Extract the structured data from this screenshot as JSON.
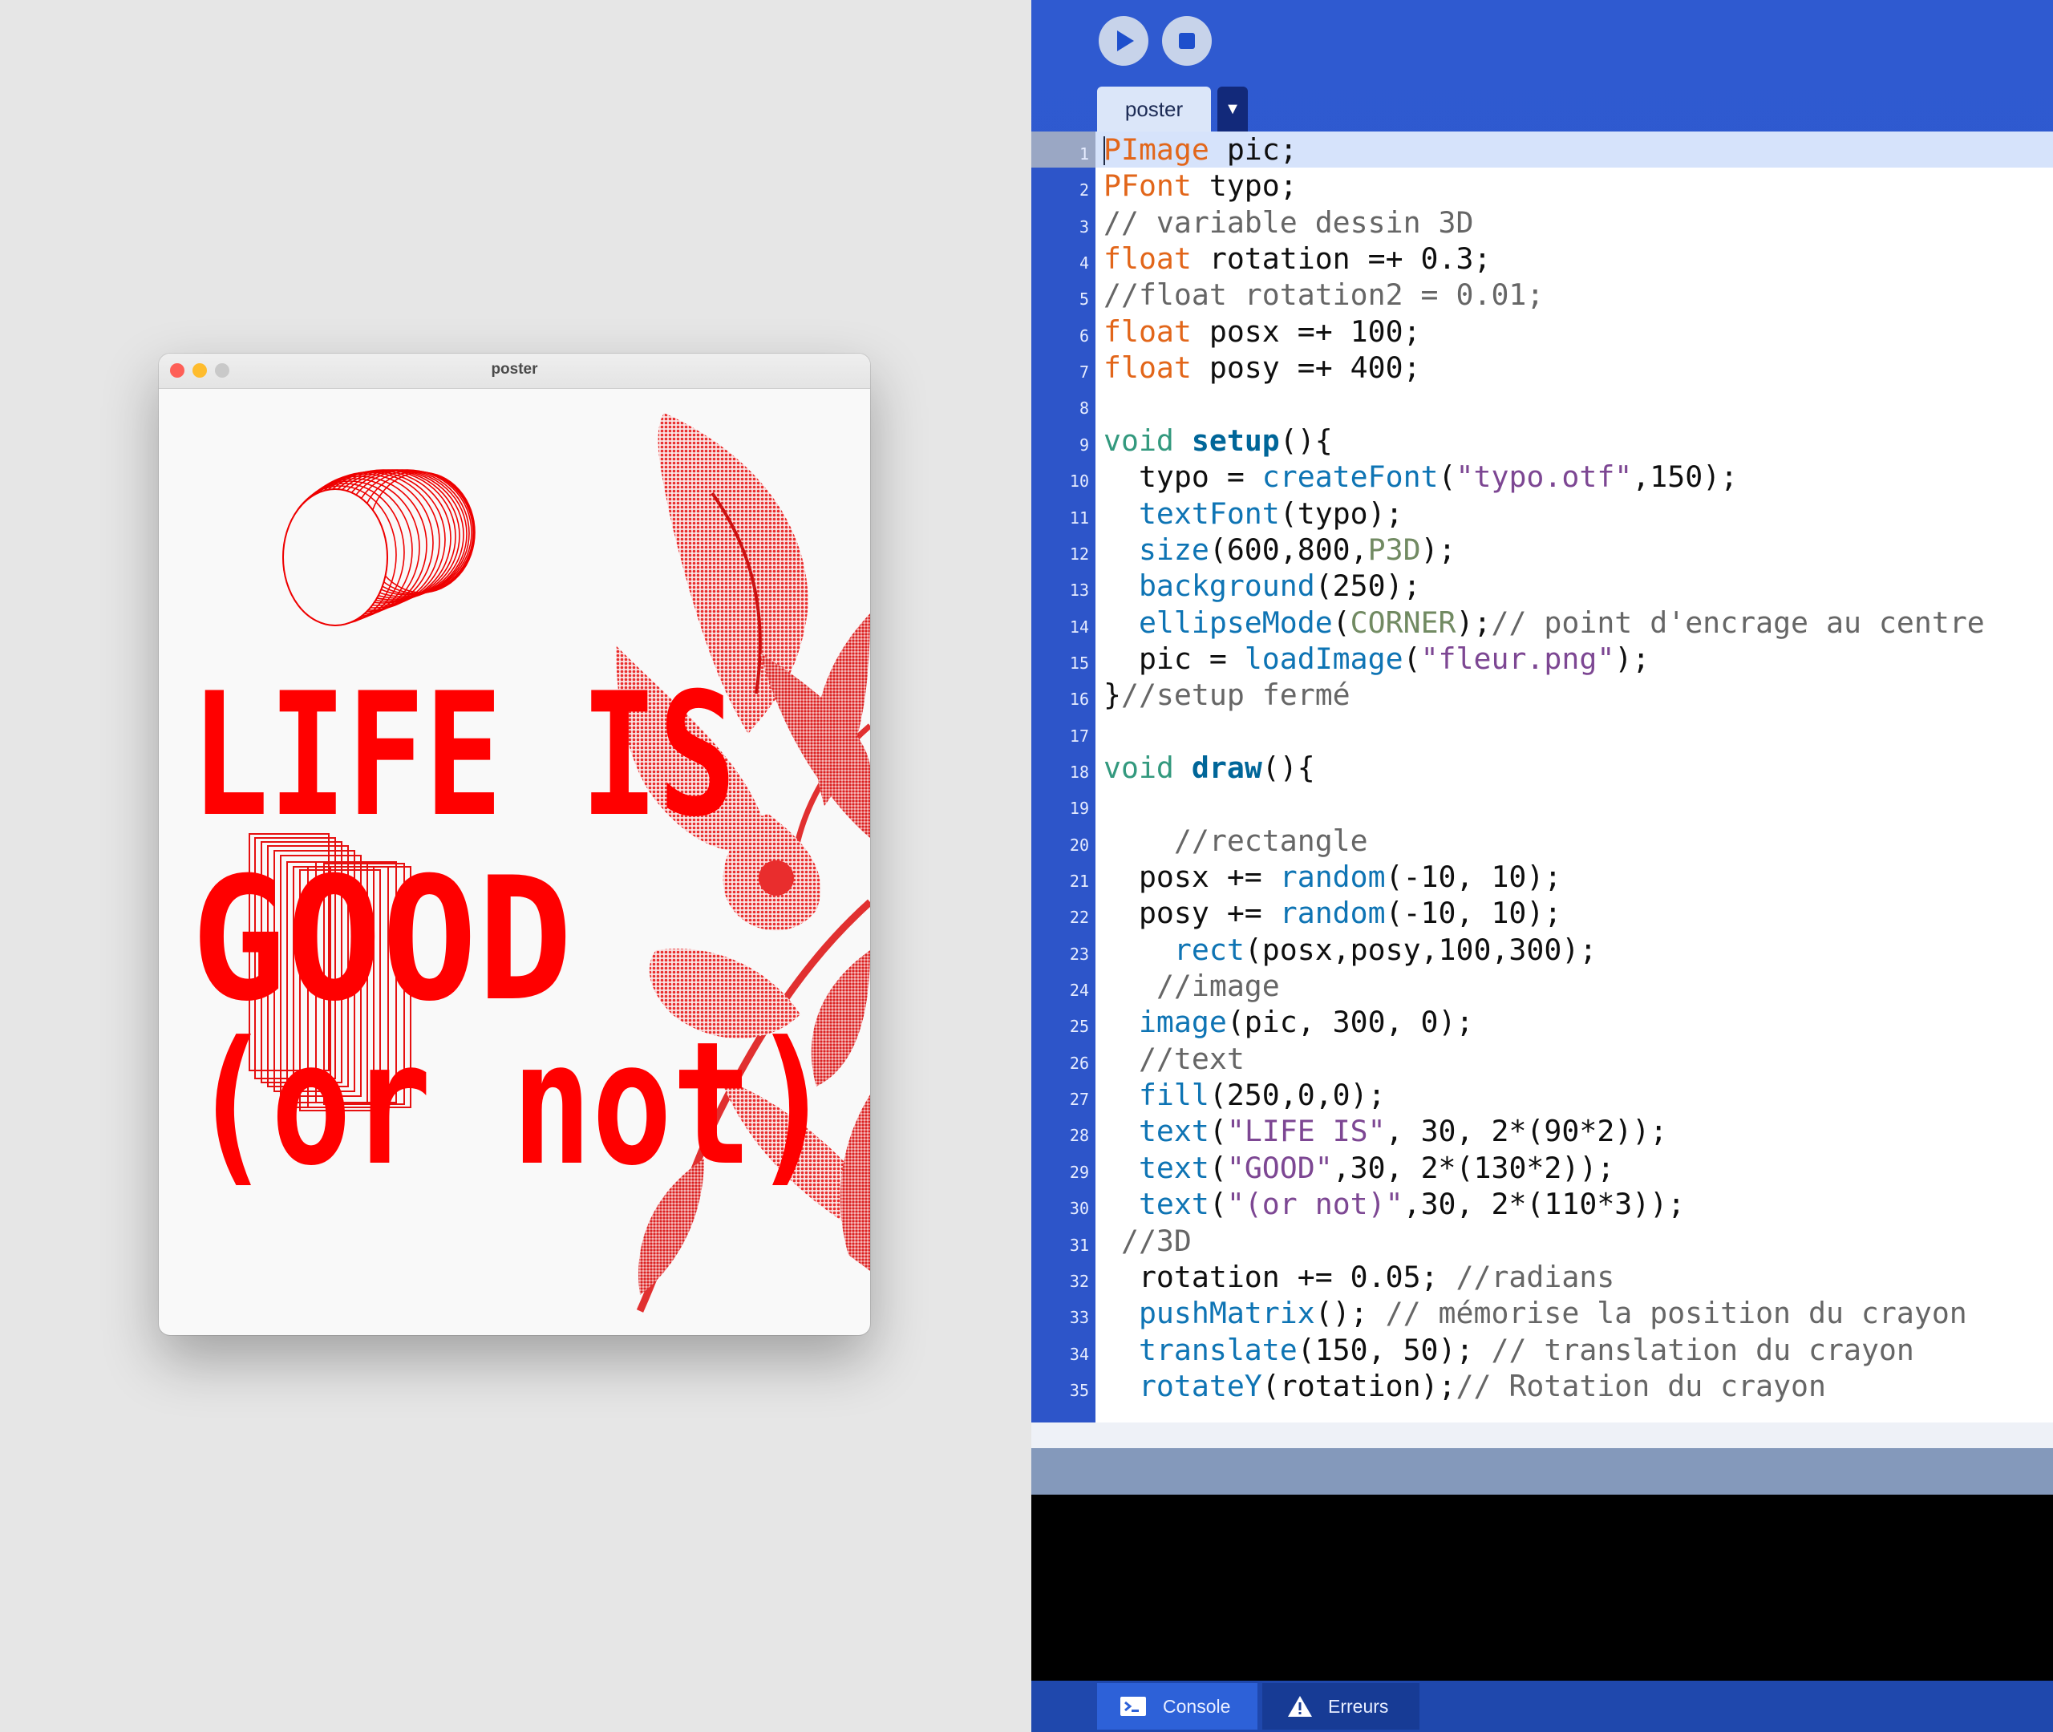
{
  "sketch_window": {
    "title": "poster",
    "poster": {
      "lines": [
        "LIFE IS",
        "GOOD",
        "(or not)"
      ],
      "text_color": "#ff0000",
      "background": "#f9f9f9"
    }
  },
  "ide": {
    "toolbar": {
      "run_icon": "play-icon",
      "stop_icon": "stop-icon"
    },
    "tabs": [
      {
        "label": "poster"
      }
    ],
    "tab_menu_icon": "▼",
    "code_lines": [
      {
        "n": "1",
        "text": "PImage pic;"
      },
      {
        "n": "2",
        "text": "PFont typo;"
      },
      {
        "n": "3",
        "text": "// variable dessin 3D"
      },
      {
        "n": "4",
        "text": "float rotation =+ 0.3;"
      },
      {
        "n": "5",
        "text": "//float rotation2 = 0.01;"
      },
      {
        "n": "6",
        "text": "float posx =+ 100;"
      },
      {
        "n": "7",
        "text": "float posy =+ 400;"
      },
      {
        "n": "8",
        "text": ""
      },
      {
        "n": "9",
        "text": "void setup(){"
      },
      {
        "n": "10",
        "text": "  typo = createFont(\"typo.otf\",150);"
      },
      {
        "n": "11",
        "text": "  textFont(typo);"
      },
      {
        "n": "12",
        "text": "  size(600,800,P3D);"
      },
      {
        "n": "13",
        "text": "  background(250);"
      },
      {
        "n": "14",
        "text": "  ellipseMode(CORNER);// point d'encrage au centre"
      },
      {
        "n": "15",
        "text": "  pic = loadImage(\"fleur.png\");"
      },
      {
        "n": "16",
        "text": "}//setup fermé"
      },
      {
        "n": "17",
        "text": ""
      },
      {
        "n": "18",
        "text": "void draw(){"
      },
      {
        "n": "19",
        "text": ""
      },
      {
        "n": "20",
        "text": "    //rectangle"
      },
      {
        "n": "21",
        "text": "  posx += random(-10, 10);"
      },
      {
        "n": "22",
        "text": "  posy += random(-10, 10);"
      },
      {
        "n": "23",
        "text": "    rect(posx,posy,100,300);"
      },
      {
        "n": "24",
        "text": "   //image"
      },
      {
        "n": "25",
        "text": "  image(pic, 300, 0);"
      },
      {
        "n": "26",
        "text": "  //text"
      },
      {
        "n": "27",
        "text": "  fill(250,0,0);"
      },
      {
        "n": "28",
        "text": "  text(\"LIFE IS\", 30, 2*(90*2));"
      },
      {
        "n": "29",
        "text": "  text(\"GOOD\",30, 2*(130*2));"
      },
      {
        "n": "30",
        "text": "  text(\"(or not)\",30, 2*(110*3));"
      },
      {
        "n": "31",
        "text": " //3D"
      },
      {
        "n": "32",
        "text": "  rotation += 0.05; //radians"
      },
      {
        "n": "33",
        "text": "  pushMatrix(); // mémorise la position du crayon"
      },
      {
        "n": "34",
        "text": "  translate(150, 50); // translation du crayon"
      },
      {
        "n": "35",
        "text": "  rotateY(rotation);// Rotation du crayon"
      }
    ],
    "active_line": 1,
    "bottom_tabs": [
      {
        "label": "Console",
        "icon": "console-icon"
      },
      {
        "label": "Erreurs",
        "icon": "warning-icon"
      }
    ],
    "colors": {
      "ide_blue": "#2f5ad0",
      "keyword": "#e2661a",
      "type": "#33997e",
      "function": "#0e74b4",
      "string": "#7d4793",
      "comment": "#666666",
      "constant": "#718a62"
    }
  }
}
